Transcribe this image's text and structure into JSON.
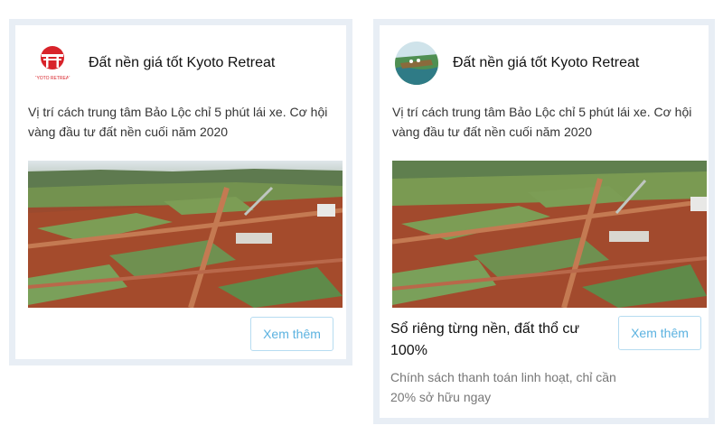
{
  "ads": [
    {
      "title": "Đất nền giá tốt Kyoto Retreat",
      "avatar_icon": "kyoto-logo-icon",
      "avatar_text": "KYOTO RETREAT",
      "description": "Vị trí cách trung tâm Bảo Lộc chỉ 5 phút lái xe. Cơ hội vàng đầu tư đất nền cuối năm 2020",
      "button_label": "Xem thêm"
    },
    {
      "title": "Đất nền giá tốt Kyoto Retreat",
      "avatar_icon": "landscape-photo-icon",
      "description": "Vị trí cách trung tâm Bảo Lộc chỉ 5 phút lái xe. Cơ hội vàng đầu tư đất nền cuối năm 2020",
      "headline": "Sổ riêng từng nền, đất thổ cư 100%",
      "subtext": "Chính sách thanh toán linh hoạt, chỉ cần 20% sở hữu ngay",
      "button_label": "Xem thêm"
    }
  ],
  "colors": {
    "card_border": "#e8eef5",
    "button_text": "#5bb2e0",
    "button_border": "#b6dcf1",
    "logo_red": "#d8232a"
  }
}
